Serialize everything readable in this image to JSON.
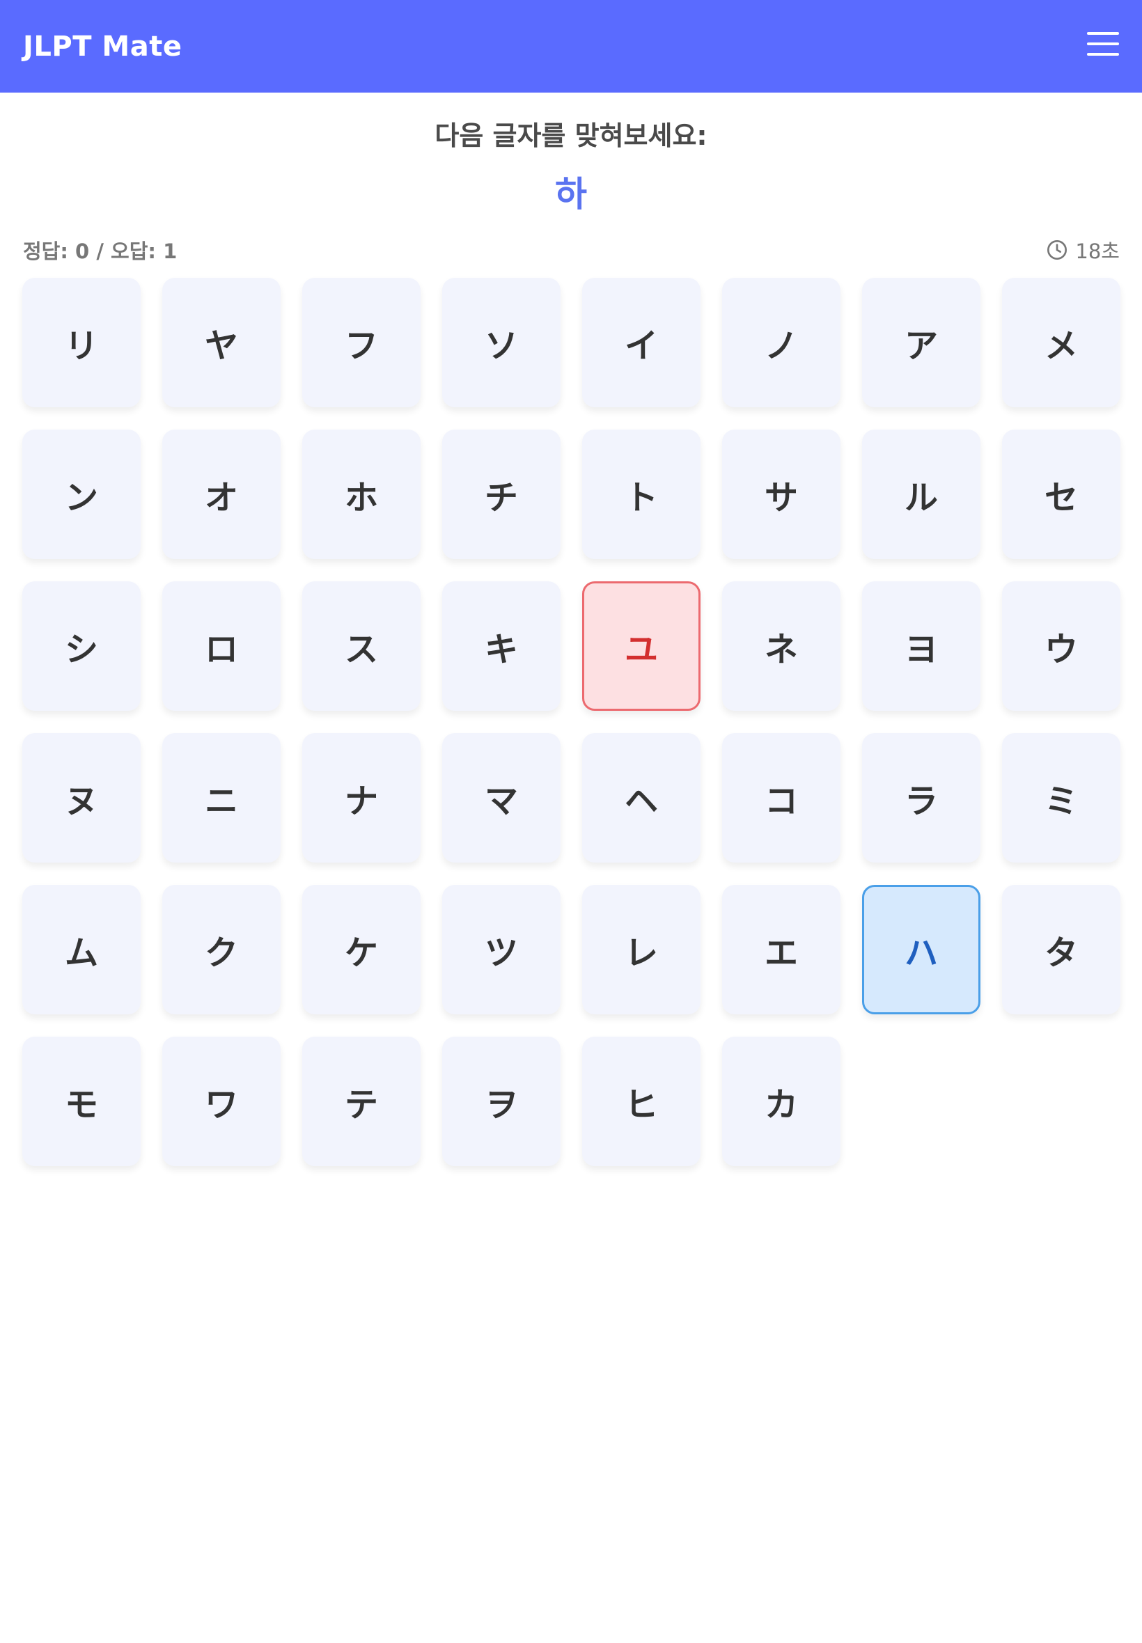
{
  "app_bar": {
    "title": "JLPT Mate",
    "menu_icon": "hamburger-menu-icon"
  },
  "prompt": {
    "label": "다음 글자를 맞혀보세요:",
    "character": "하"
  },
  "status": {
    "score": "정답: 0 / 오답: 1",
    "timer_icon": "clock-icon",
    "timer": "18초"
  },
  "colors": {
    "app_bar": "#5a6bff",
    "prompt_char": "#5a73f0",
    "wrong_bg": "#fde0e2",
    "wrong_border": "#ec6a6f",
    "correct_bg": "#d6e9fd",
    "correct_border": "#4a9fe8"
  },
  "grid": {
    "cells": [
      {
        "char": "リ",
        "state": "normal"
      },
      {
        "char": "ヤ",
        "state": "normal"
      },
      {
        "char": "フ",
        "state": "normal"
      },
      {
        "char": "ソ",
        "state": "normal"
      },
      {
        "char": "イ",
        "state": "normal"
      },
      {
        "char": "ノ",
        "state": "normal"
      },
      {
        "char": "ア",
        "state": "normal"
      },
      {
        "char": "メ",
        "state": "normal"
      },
      {
        "char": "ン",
        "state": "normal"
      },
      {
        "char": "オ",
        "state": "normal"
      },
      {
        "char": "ホ",
        "state": "normal"
      },
      {
        "char": "チ",
        "state": "normal"
      },
      {
        "char": "ト",
        "state": "normal"
      },
      {
        "char": "サ",
        "state": "normal"
      },
      {
        "char": "ル",
        "state": "normal"
      },
      {
        "char": "セ",
        "state": "normal"
      },
      {
        "char": "シ",
        "state": "normal"
      },
      {
        "char": "ロ",
        "state": "normal"
      },
      {
        "char": "ス",
        "state": "normal"
      },
      {
        "char": "キ",
        "state": "normal"
      },
      {
        "char": "ユ",
        "state": "wrong"
      },
      {
        "char": "ネ",
        "state": "normal"
      },
      {
        "char": "ヨ",
        "state": "normal"
      },
      {
        "char": "ウ",
        "state": "normal"
      },
      {
        "char": "ヌ",
        "state": "normal"
      },
      {
        "char": "ニ",
        "state": "normal"
      },
      {
        "char": "ナ",
        "state": "normal"
      },
      {
        "char": "マ",
        "state": "normal"
      },
      {
        "char": "ヘ",
        "state": "normal"
      },
      {
        "char": "コ",
        "state": "normal"
      },
      {
        "char": "ラ",
        "state": "normal"
      },
      {
        "char": "ミ",
        "state": "normal"
      },
      {
        "char": "ム",
        "state": "normal"
      },
      {
        "char": "ク",
        "state": "normal"
      },
      {
        "char": "ケ",
        "state": "normal"
      },
      {
        "char": "ツ",
        "state": "normal"
      },
      {
        "char": "レ",
        "state": "normal"
      },
      {
        "char": "エ",
        "state": "normal"
      },
      {
        "char": "ハ",
        "state": "correct"
      },
      {
        "char": "タ",
        "state": "normal"
      },
      {
        "char": "モ",
        "state": "normal"
      },
      {
        "char": "ワ",
        "state": "normal"
      },
      {
        "char": "テ",
        "state": "normal"
      },
      {
        "char": "ヲ",
        "state": "normal"
      },
      {
        "char": "ヒ",
        "state": "normal"
      },
      {
        "char": "カ",
        "state": "normal"
      }
    ]
  }
}
